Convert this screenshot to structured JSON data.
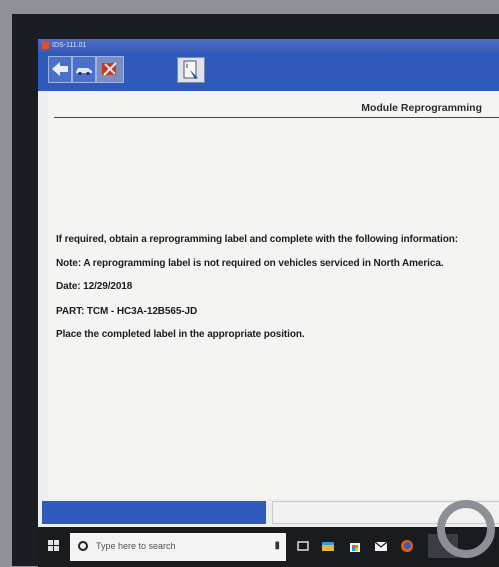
{
  "window": {
    "title": "IDS-111.01"
  },
  "toolbar": {
    "buttons": [
      "back-arrow",
      "vehicle",
      "tools"
    ],
    "info_icon": "info-tab-icon"
  },
  "page": {
    "heading": "Module Reprogramming",
    "lines": [
      "If required, obtain a reprogramming label and complete with the following information:",
      "Note: A reprogramming label is not required on vehicles serviced in North America.",
      "Date: 12/29/2018",
      "PART: TCM - HC3A-12B565-JD",
      "Place the completed label in the appropriate position."
    ]
  },
  "taskbar": {
    "search_placeholder": "Type here to search"
  },
  "colors": {
    "toolbar_blue": "#2f59ba",
    "page_bg": "#f4f5f3",
    "taskbar": "#1a1b1f"
  }
}
